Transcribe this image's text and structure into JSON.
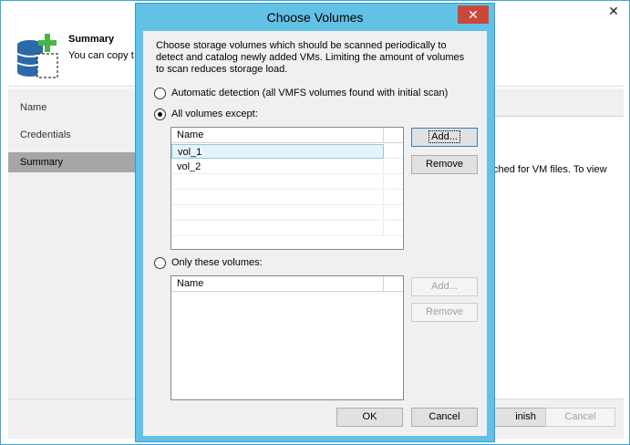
{
  "wizard": {
    "close_glyph": "✕",
    "header": {
      "title": "Summary",
      "description": "You can copy t"
    },
    "nav": [
      {
        "label": "Name"
      },
      {
        "label": "Credentials"
      },
      {
        "label": "Summary"
      }
    ],
    "content_text": "ched for VM files. To view",
    "footer": {
      "finish_label": "inish",
      "cancel_label": "Cancel"
    }
  },
  "dialog": {
    "title": "Choose Volumes",
    "close_glyph": "✕",
    "intro": "Choose storage volumes which should be scanned periodically to detect and catalog newly added VMs. Limiting the amount of volumes to scan reduces storage load.",
    "options": {
      "automatic_label": "Automatic detection (all VMFS volumes found with initial scan)",
      "all_except_label": "All volumes except:",
      "only_these_label": "Only these volumes:",
      "selected": "all_except"
    },
    "except_list": {
      "column": "Name",
      "rows": [
        "vol_1",
        "vol_2"
      ],
      "selected_row": "vol_1",
      "add_label": "Add...",
      "remove_label": "Remove"
    },
    "only_list": {
      "column": "Name",
      "rows": [],
      "add_label": "Add...",
      "remove_label": "Remove"
    },
    "ok_label": "OK",
    "cancel_label": "Cancel"
  }
}
